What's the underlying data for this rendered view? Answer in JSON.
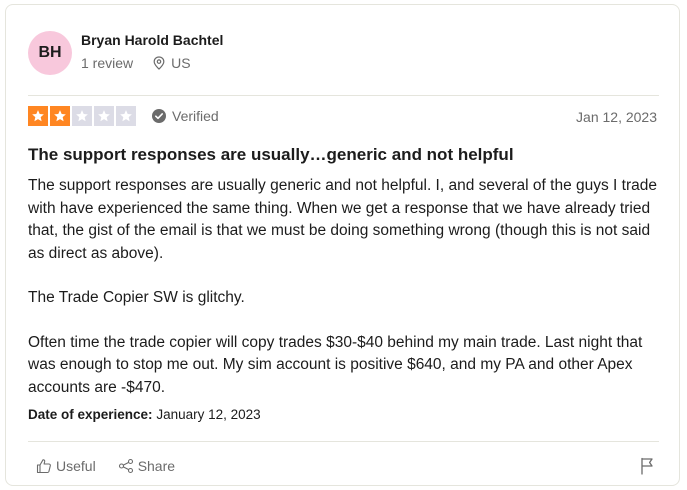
{
  "reviewer": {
    "initials": "BH",
    "name": "Bryan Harold Bachtel",
    "review_count": "1 review",
    "location": "US",
    "avatar_color": "#f8c8dc"
  },
  "rating": {
    "value": 2,
    "max": 5,
    "filled_color": "#ff8622",
    "empty_color": "#dcdce6"
  },
  "verified_label": "Verified",
  "date": "Jan 12, 2023",
  "title": "The support responses are usually…generic and not helpful",
  "body": [
    "The support responses are usually generic and not helpful. I, and several of the guys I trade with have experienced the same thing. When we get a response that we have already tried that, the gist of the email is that we must be doing something wrong (though this is not said as direct as above).",
    "The Trade Copier SW is glitchy.",
    "Often time the trade copier will copy trades $30-$40 behind my main trade. Last night that was enough to stop me out. My sim account is positive $640, and my PA and other Apex accounts are -$470."
  ],
  "experience": {
    "label": "Date of experience:",
    "value": "January 12, 2023"
  },
  "actions": {
    "useful_label": "Useful",
    "share_label": "Share"
  },
  "icons": {
    "location": "location-pin-icon",
    "verified": "check-circle-icon",
    "useful": "thumbs-up-icon",
    "share": "share-icon",
    "flag": "flag-icon",
    "star": "star-icon"
  }
}
